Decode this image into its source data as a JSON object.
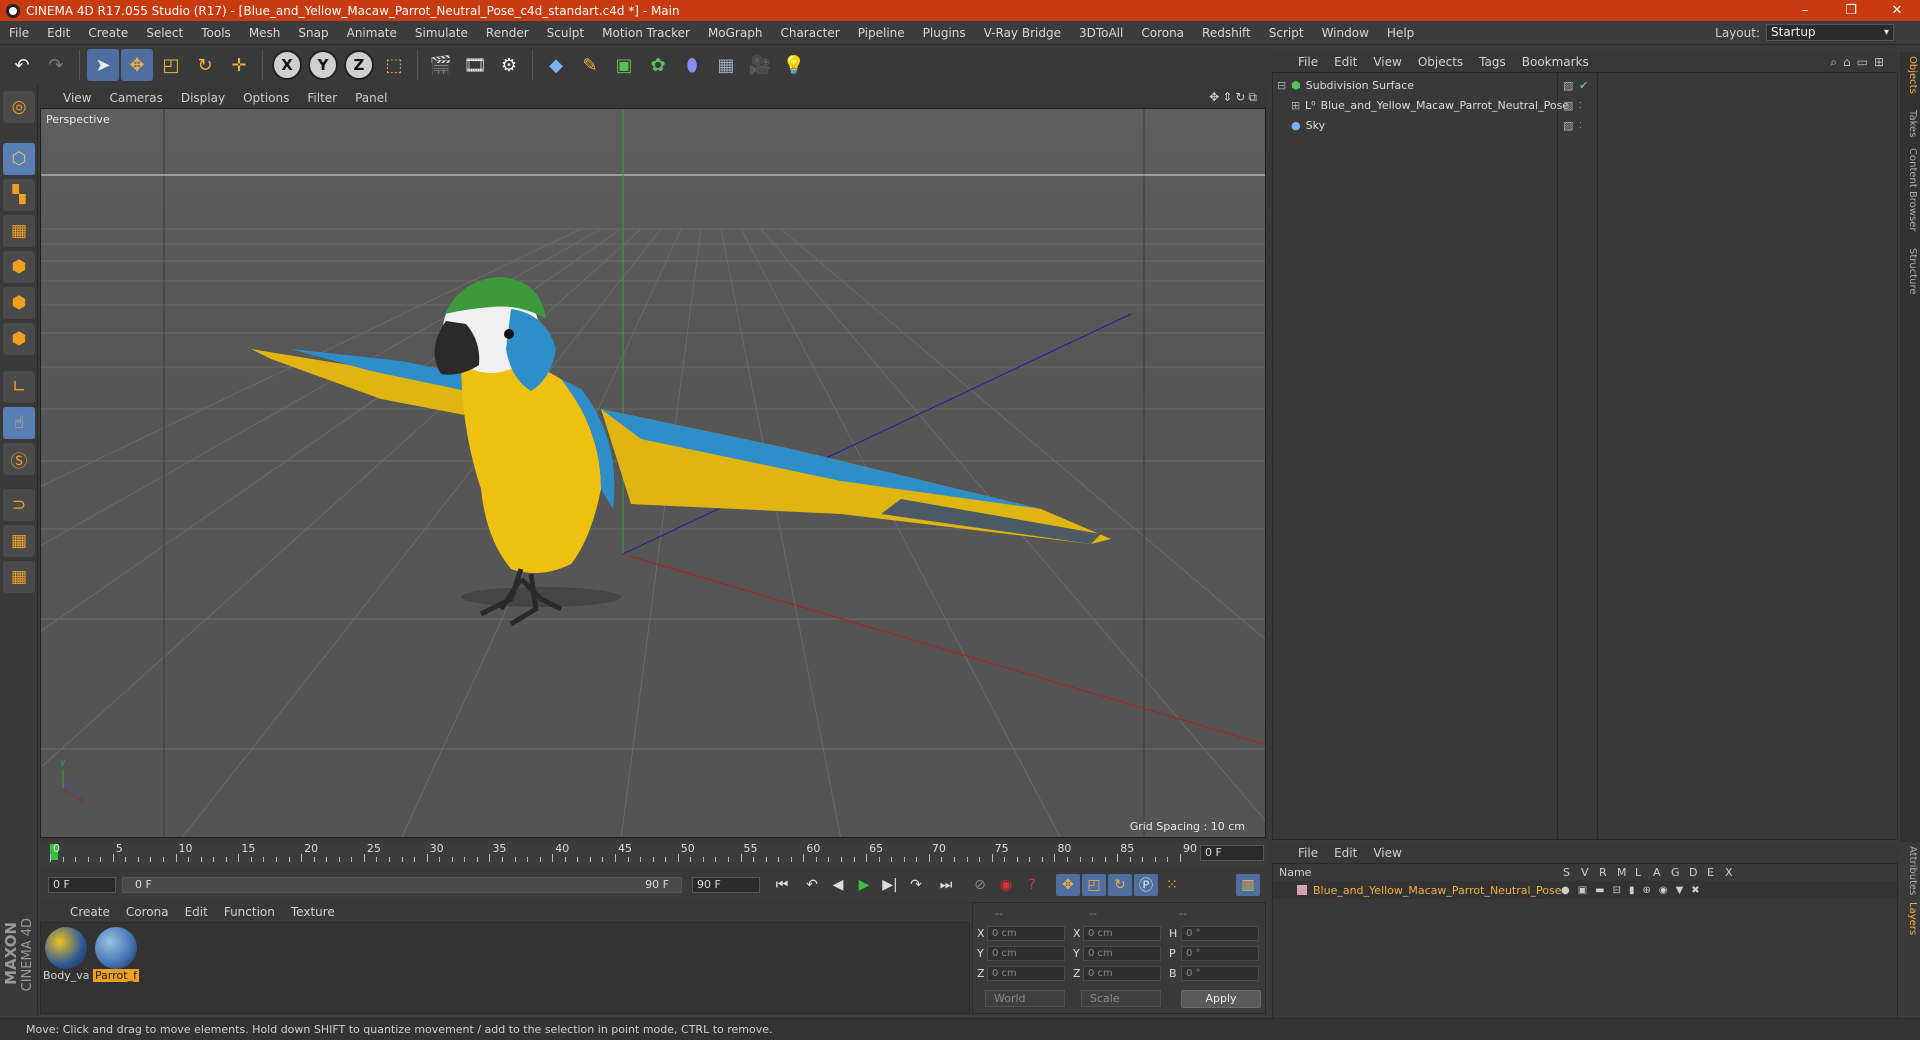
{
  "window": {
    "title": "CINEMA 4D R17.055 Studio (R17) - [Blue_and_Yellow_Macaw_Parrot_Neutral_Pose_c4d_standart.c4d *] - Main"
  },
  "menu": [
    "File",
    "Edit",
    "Create",
    "Select",
    "Tools",
    "Mesh",
    "Snap",
    "Animate",
    "Simulate",
    "Render",
    "Sculpt",
    "Motion Tracker",
    "MoGraph",
    "Character",
    "Pipeline",
    "Plugins",
    "V-Ray Bridge",
    "3DToAll",
    "Corona",
    "Redshift",
    "Script",
    "Window",
    "Help"
  ],
  "layout": {
    "label": "Layout:",
    "value": "Startup"
  },
  "toolbar": {
    "axis_x": "X",
    "axis_y": "Y",
    "axis_z": "Z"
  },
  "viewport": {
    "menu": [
      "View",
      "Cameras",
      "Display",
      "Options",
      "Filter",
      "Panel"
    ],
    "camera_label": "Perspective",
    "grid_spacing": "Grid Spacing : 10 cm"
  },
  "objects": {
    "menu": [
      "File",
      "Edit",
      "View",
      "Objects",
      "Tags",
      "Bookmarks"
    ],
    "items": [
      {
        "name": "Subdivision Surface"
      },
      {
        "name": "Blue_and_Yellow_Macaw_Parrot_Neutral_Pose"
      },
      {
        "name": "Sky"
      }
    ]
  },
  "side_tabs": [
    "Objects",
    "Takes",
    "Content Browser",
    "Structure"
  ],
  "side_tabs_bottom": [
    "Attributes",
    "Layers"
  ],
  "layers": {
    "menu": [
      "File",
      "Edit",
      "View"
    ],
    "columns": [
      "Name",
      "S",
      "V",
      "R",
      "M",
      "L",
      "A",
      "G",
      "D",
      "E",
      "X"
    ],
    "row_name": "Blue_and_Yellow_Macaw_Parrot_Neutral_Pose",
    "layer_color": "#d7a0b8"
  },
  "timeline": {
    "ticks": [
      "0",
      "5",
      "10",
      "15",
      "20",
      "25",
      "30",
      "35",
      "40",
      "45",
      "50",
      "55",
      "60",
      "65",
      "70",
      "75",
      "80",
      "85",
      "90"
    ],
    "current_frame": "0 F",
    "start_field": "0 F",
    "range_start": "0 F",
    "range_end": "90 F",
    "end_field": "90 F"
  },
  "materials": {
    "menu": [
      "Create",
      "Corona",
      "Edit",
      "Function",
      "Texture"
    ],
    "items": [
      {
        "name": "Body_va"
      },
      {
        "name": "Parrot_f"
      }
    ]
  },
  "coords": {
    "header_1": "--",
    "header_2": "--",
    "header_3": "--",
    "rows": [
      {
        "a": "X",
        "av": "0 cm",
        "b": "X",
        "bv": "0 cm",
        "c": "H",
        "cv": "0 °"
      },
      {
        "a": "Y",
        "av": "0 cm",
        "b": "Y",
        "bv": "0 cm",
        "c": "P",
        "cv": "0 °"
      },
      {
        "a": "Z",
        "av": "0 cm",
        "b": "Z",
        "bv": "0 cm",
        "c": "B",
        "cv": "0 °"
      }
    ],
    "world": "World",
    "scale": "Scale",
    "apply": "Apply"
  },
  "logo": {
    "maxon": "MAXON",
    "c4d": "CINEMA 4D"
  },
  "status": "Move: Click and drag to move elements. Hold down SHIFT to quantize movement / add to the selection in point mode, CTRL to remove.",
  "colors": {
    "title_bar": "#c83a10",
    "accent": "#f0b040",
    "tool_active": "#4e6ea0"
  }
}
